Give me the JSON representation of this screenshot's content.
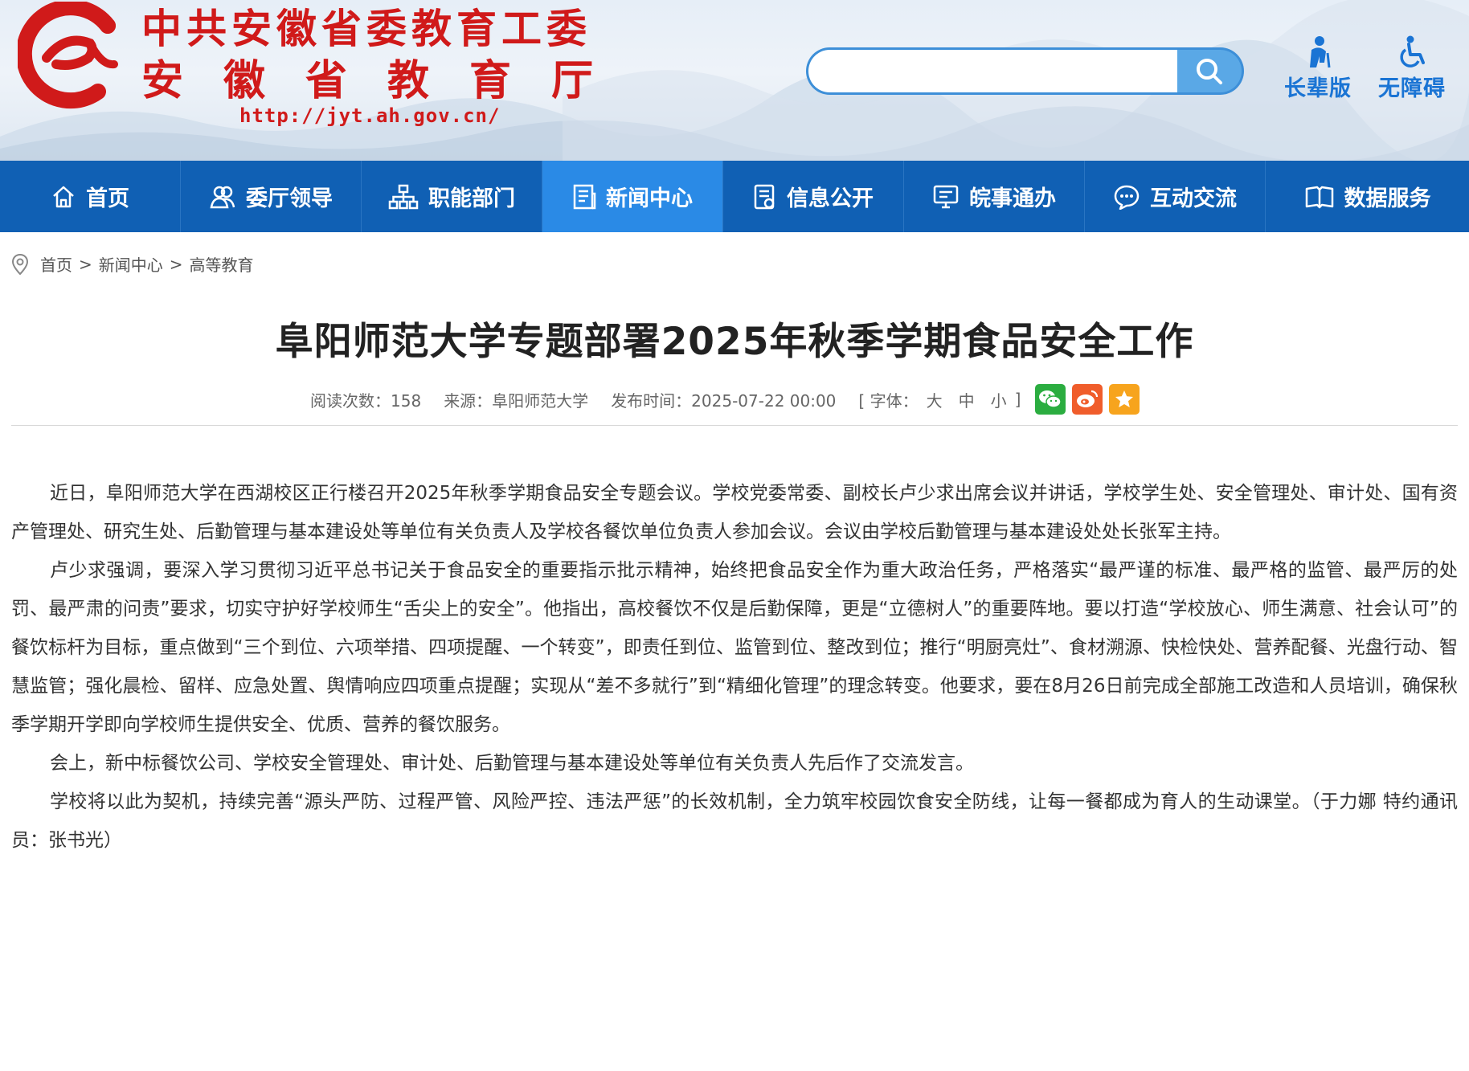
{
  "header": {
    "title_line1": "中共安徽省委教育工委",
    "title_line2": "安徽省教育厅",
    "site_url": "http://jyt.ah.gov.cn/",
    "search": {
      "placeholder": "",
      "value": ""
    },
    "elder_label": "长辈版",
    "barrier_label": "无障碍"
  },
  "nav": {
    "items": [
      {
        "label": "首页",
        "icon": "home-icon"
      },
      {
        "label": "委厅领导",
        "icon": "people-icon"
      },
      {
        "label": "职能部门",
        "icon": "org-chart-icon"
      },
      {
        "label": "新闻中心",
        "icon": "news-icon",
        "active": true
      },
      {
        "label": "信息公开",
        "icon": "document-icon"
      },
      {
        "label": "皖事通办",
        "icon": "monitor-icon"
      },
      {
        "label": "互动交流",
        "icon": "chat-icon"
      },
      {
        "label": "数据服务",
        "icon": "book-icon"
      }
    ]
  },
  "breadcrumb": [
    "首页",
    "新闻中心",
    "高等教育"
  ],
  "article": {
    "title": "阜阳师范大学专题部署2025年秋季学期食品安全工作",
    "meta": {
      "reads": "阅读次数：158",
      "source": "来源：阜阳师范大学",
      "published": "发布时间：2025-07-22 00:00",
      "font_prefix": "[ 字体：",
      "font_large": "大",
      "font_medium": "中",
      "font_small": "小",
      "font_suffix": "]"
    },
    "paragraphs": [
      "近日，阜阳师范大学在西湖校区正行楼召开2025年秋季学期食品安全专题会议。学校党委常委、副校长卢少求出席会议并讲话，学校学生处、安全管理处、审计处、国有资产管理处、研究生处、后勤管理与基本建设处等单位有关负责人及学校各餐饮单位负责人参加会议。会议由学校后勤管理与基本建设处处长张军主持。",
      "卢少求强调，要深入学习贯彻习近平总书记关于食品安全的重要指示批示精神，始终把食品安全作为重大政治任务，严格落实“最严谨的标准、最严格的监管、最严厉的处罚、最严肃的问责”要求，切实守护好学校师生“舌尖上的安全”。他指出，高校餐饮不仅是后勤保障，更是“立德树人”的重要阵地。要以打造“学校放心、师生满意、社会认可”的餐饮标杆为目标，重点做到“三个到位、六项举措、四项提醒、一个转变”，即责任到位、监管到位、整改到位；推行“明厨亮灶”、食材溯源、快检快处、营养配餐、光盘行动、智慧监管；强化晨检、留样、应急处置、舆情响应四项重点提醒；实现从“差不多就行”到“精细化管理”的理念转变。他要求，要在8月26日前完成全部施工改造和人员培训，确保秋季学期开学即向学校师生提供安全、优质、营养的餐饮服务。",
      "会上，新中标餐饮公司、学校安全管理处、审计处、后勤管理与基本建设处等单位有关负责人先后作了交流发言。",
      "学校将以此为契机，持续完善“源头严防、过程严管、风险严控、违法严惩”的长效机制，全力筑牢校园饮食安全防线，让每一餐都成为育人的生动课堂。（于力娜 特约通讯员：张书光）"
    ]
  },
  "colors": {
    "brand_red": "#d01a1a",
    "nav_bg": "#1060b4",
    "nav_active": "#2a8ae6",
    "accent_blue": "#1a74d4"
  }
}
